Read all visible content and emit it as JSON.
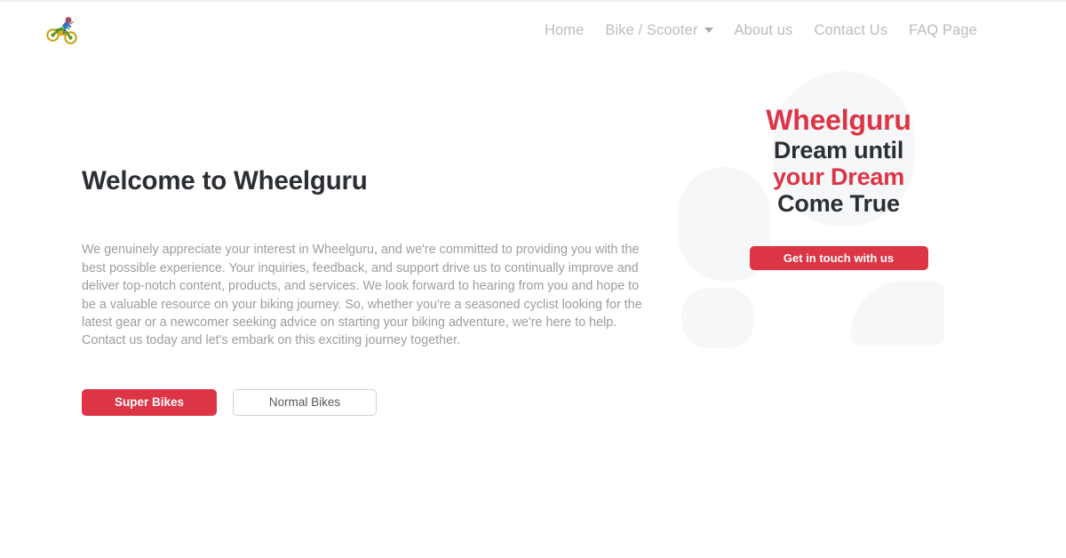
{
  "site": {
    "title": "Wheelguru",
    "logo_icon": "motorbike-rider-icon"
  },
  "colors": {
    "accent_red": "#dc3545",
    "heading_dark": "#2b2f33",
    "body_gray": "#9a9da0",
    "nav_gray": "#b9bcbe",
    "blob_gray": "#f6f7f9",
    "page_background": "#ffffff"
  },
  "nav": {
    "items": [
      {
        "label": "Home",
        "has_dropdown": false
      },
      {
        "label": "Bike / Scooter",
        "has_dropdown": true
      },
      {
        "label": "About us",
        "has_dropdown": false
      },
      {
        "label": "Contact Us",
        "has_dropdown": false
      },
      {
        "label": "FAQ Page",
        "has_dropdown": false
      }
    ]
  },
  "hero": {
    "title": "Welcome to Wheelguru",
    "paragraph": "We genuinely appreciate your interest in Wheelguru, and we're committed to providing you with the best possible experience. Your inquiries, feedback, and support drive us to continually improve and deliver top-notch content, products, and services. We look forward to hearing from you and hope to be a valuable resource on your biking journey. So, whether you're a seasoned cyclist looking for the latest gear or a newcomer seeking advice on starting your biking adventure, we're here to help. Contact us today and let's embark on this exciting journey together.",
    "buttons": {
      "primary_label": "Super Bikes",
      "outline_label": "Normal Bikes"
    }
  },
  "banner": {
    "brand_line": "Wheelguru",
    "line_two": "Dream until",
    "line_three": "your Dream",
    "line_four": "Come True",
    "cta_label": "Get in touch with us"
  }
}
